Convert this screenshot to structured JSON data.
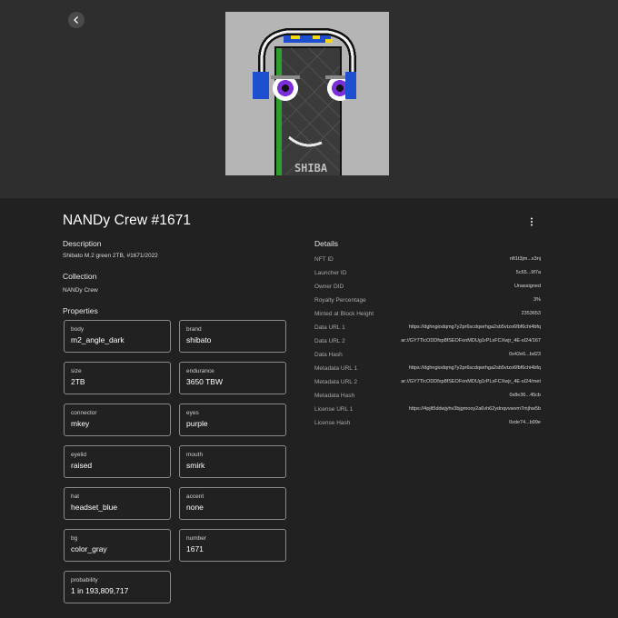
{
  "nft": {
    "title": "NANDy Crew #1671",
    "image_text": "SHIBA"
  },
  "description": {
    "heading": "Description",
    "text": "Shibato M.2 green 2TB, #1671/2022"
  },
  "collection": {
    "heading": "Collection",
    "text": "NANDy Crew"
  },
  "properties": {
    "heading": "Properties",
    "items": [
      {
        "key": "body",
        "value": "m2_angle_dark"
      },
      {
        "key": "brand",
        "value": "shibato"
      },
      {
        "key": "size",
        "value": "2TB"
      },
      {
        "key": "endurance",
        "value": "3650 TBW"
      },
      {
        "key": "connector",
        "value": "mkey"
      },
      {
        "key": "eyes",
        "value": "purple"
      },
      {
        "key": "eyelid",
        "value": "raised"
      },
      {
        "key": "mouth",
        "value": "smirk"
      },
      {
        "key": "hat",
        "value": "headset_blue"
      },
      {
        "key": "accent",
        "value": "none"
      },
      {
        "key": "bg",
        "value": "color_gray"
      },
      {
        "key": "number",
        "value": "1671"
      },
      {
        "key": "probability",
        "value": "1 in 193,809,717"
      }
    ]
  },
  "details": {
    "heading": "Details",
    "rows": [
      {
        "key": "NFT ID",
        "value": "nft1t3jm...x3nj"
      },
      {
        "key": "Launcher ID",
        "value": "5c65...9f7a"
      },
      {
        "key": "Owner DID",
        "value": "Unassigned"
      },
      {
        "key": "Royalty Percentage",
        "value": "3%"
      },
      {
        "key": "Minted at Block Height",
        "value": "2353653"
      },
      {
        "key": "Data URL 1",
        "value": "https://dghngiodqmg7y2pr6scdqwrhga2sb5vtzo6fbf6chi4bfq"
      },
      {
        "key": "Data URL 2",
        "value": "ar://GY7TlcODDfxp8fSEOFonMDUg1rPLxFCXwjr_4E-sI24/167"
      },
      {
        "key": "Data Hash",
        "value": "0x42e6...bd23"
      },
      {
        "key": "Metadata URL 1",
        "value": "https://dghngiodqmg7y2pr6scdqwrhga2sb5vtzo6fbf6chi4bfq"
      },
      {
        "key": "Metadata URL 2",
        "value": "ar://GY7TlcODDfxp8fSEOFonMDUg1rPLxFCXwjr_4E-sI24/met"
      },
      {
        "key": "Metadata Hash",
        "value": "0x8e36...45cb"
      },
      {
        "key": "License URL 1",
        "value": "https://4pjlt5ddwjyhv3bjgmooy2a6vh62ydnqvvwvm7mjhw5b"
      },
      {
        "key": "License Hash",
        "value": "0xde74...b99e"
      }
    ]
  },
  "icons": {
    "back": "chevron-left-icon",
    "menu": "more-vert-icon"
  },
  "colors": {
    "background": "#212121",
    "hero_background": "#2e2e2e",
    "card_border": "#8a8a8a",
    "eye_purple": "#7b2fd6",
    "headset_blue": "#1e4fd1",
    "stripe_green": "#2f9e2f"
  }
}
